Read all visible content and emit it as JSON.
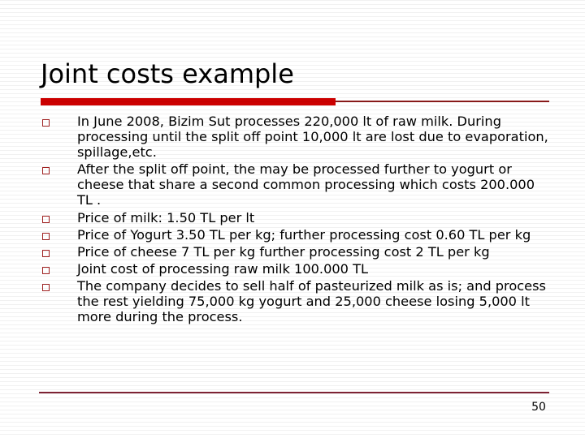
{
  "slide": {
    "title": "Joint costs example",
    "page_number": "50",
    "accent_color": "#cc0000",
    "rule_color": "#7d2233",
    "bullet_marker_color": "#a02020",
    "bullet_icon": "hollow-square-bullet",
    "bullets": [
      "In June 2008, Bizim Sut processes 220,000 lt of raw milk. During processing until the split off point 10,000 lt are lost due to evaporation, spillage,etc.",
      "After the split off point, the may be processed further to yogurt or cheese that share a second common processing which costs 200.000 TL .",
      "Price of milk: 1.50 TL per lt",
      "Price of Yogurt 3.50 TL per kg; further processing cost 0.60 TL per kg",
      "Price of cheese 7 TL per kg  further processing cost 2 TL per kg",
      "Joint cost of processing raw milk 100.000 TL",
      "The company decides to sell half of pasteurized milk as is; and process the rest yielding 75,000 kg yogurt and 25,000 cheese losing 5,000 lt more during the process."
    ]
  }
}
